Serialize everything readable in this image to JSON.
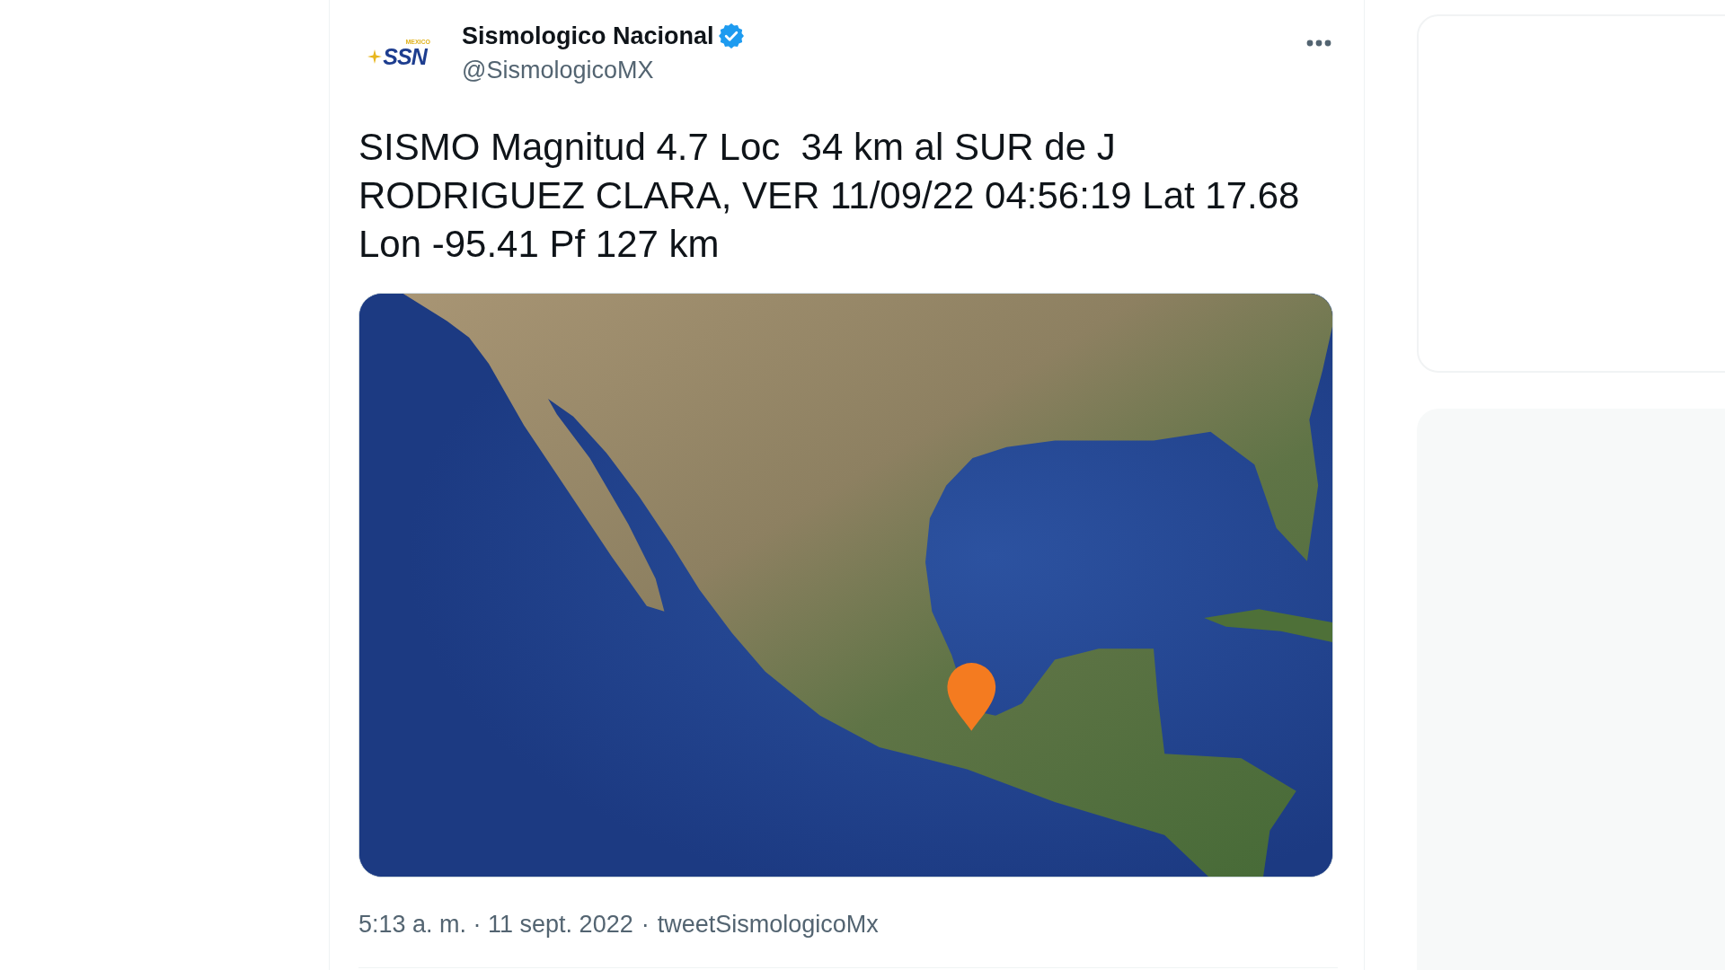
{
  "author": {
    "name": "Sismologico Nacional",
    "verified": true,
    "handle": "@SismologicoMX",
    "avatar": {
      "caption": "MEXICO",
      "logo_text": "SSN"
    }
  },
  "tweet": {
    "text": "SISMO Magnitud 4.7 Loc  34 km al SUR de J RODRIGUEZ CLARA, VER 11/09/22 04:56:19 Lat 17.68 Lon -95.41 Pf 127 km"
  },
  "media": {
    "kind": "map"
  },
  "footer": {
    "timestamp": "5:13 a. m. · 11 sept. 2022",
    "separator": "·",
    "source": "tweetSismologicoMx"
  }
}
